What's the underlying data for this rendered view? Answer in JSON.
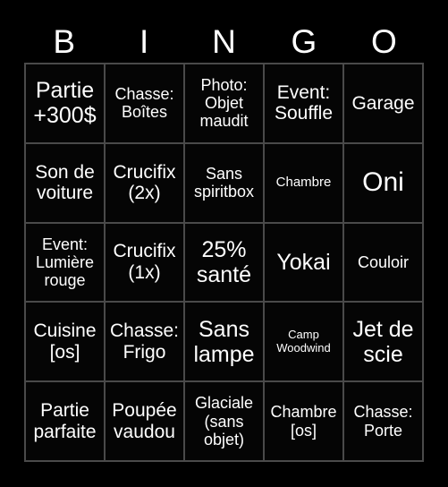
{
  "board": {
    "title": "BINGO",
    "background_color": "#000000",
    "grid_line_color": "#4a4a4a",
    "cell_background_color": "#050505",
    "text_color": "#ffffff",
    "columns": 5,
    "rows": 5,
    "header_letters": [
      "B",
      "I",
      "N",
      "G",
      "O"
    ],
    "cells": [
      {
        "text": "Partie +300$",
        "size": "lg"
      },
      {
        "text": "Chasse: Boîtes",
        "size": "sm"
      },
      {
        "text": "Photo: Objet maudit",
        "size": "sm"
      },
      {
        "text": "Event: Souffle",
        "size": "md"
      },
      {
        "text": "Garage",
        "size": "md"
      },
      {
        "text": "Son de voiture",
        "size": "md"
      },
      {
        "text": "Crucifix (2x)",
        "size": "md"
      },
      {
        "text": "Sans spiritbox",
        "size": "sm"
      },
      {
        "text": "Chambre",
        "size": "xs"
      },
      {
        "text": "Oni",
        "size": "xl"
      },
      {
        "text": "Event: Lumière rouge",
        "size": "sm"
      },
      {
        "text": "Crucifix (1x)",
        "size": "md"
      },
      {
        "text": "25% santé",
        "size": "lg"
      },
      {
        "text": "Yokai",
        "size": "lg"
      },
      {
        "text": "Couloir",
        "size": "sm"
      },
      {
        "text": "Cuisine [os]",
        "size": "md"
      },
      {
        "text": "Chasse: Frigo",
        "size": "md"
      },
      {
        "text": "Sans lampe",
        "size": "lg"
      },
      {
        "text": "Camp Woodwind",
        "size": "xxs"
      },
      {
        "text": "Jet de scie",
        "size": "lg"
      },
      {
        "text": "Partie parfaite",
        "size": "md"
      },
      {
        "text": "Poupée vaudou",
        "size": "md"
      },
      {
        "text": "Glaciale (sans objet)",
        "size": "sm"
      },
      {
        "text": "Chambre [os]",
        "size": "sm"
      },
      {
        "text": "Chasse: Porte",
        "size": "sm"
      }
    ]
  }
}
